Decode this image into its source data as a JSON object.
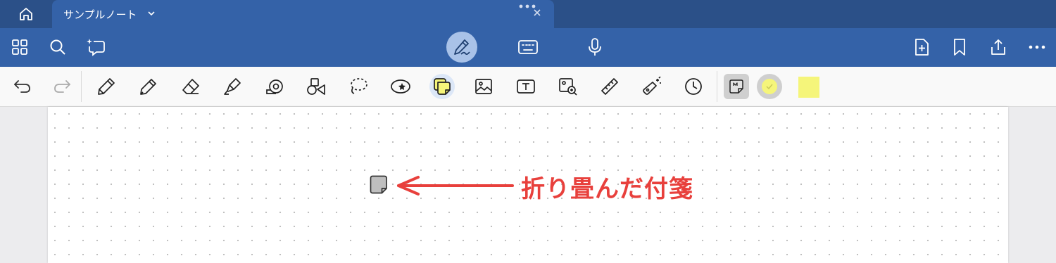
{
  "tab": {
    "title": "サンプルノート"
  },
  "note": {
    "annotation": "折り畳んだ付箋"
  },
  "colors": {
    "tab_bar": "#2b5088",
    "top_bar": "#3462a8",
    "accent": "#e8403c",
    "sticky_yellow": "#f5f57a"
  },
  "icons": {
    "top_left": [
      "apps-grid-icon",
      "search-icon",
      "ai-assist-icon"
    ],
    "modes": [
      "pen-mode-icon",
      "keyboard-icon",
      "microphone-icon"
    ],
    "top_right": [
      "add-page-icon",
      "bookmark-icon",
      "share-icon",
      "more-icon"
    ],
    "tools": [
      "undo-icon",
      "redo-icon",
      "pen-icon",
      "pencil-icon",
      "eraser-icon",
      "highlighter-icon",
      "tape-icon",
      "shapes-icon",
      "lasso-icon",
      "sticker-icon",
      "sticky-note-icon",
      "image-icon",
      "text-box-icon",
      "image-search-icon",
      "ruler-icon",
      "laser-pointer-icon",
      "clock-icon"
    ]
  }
}
